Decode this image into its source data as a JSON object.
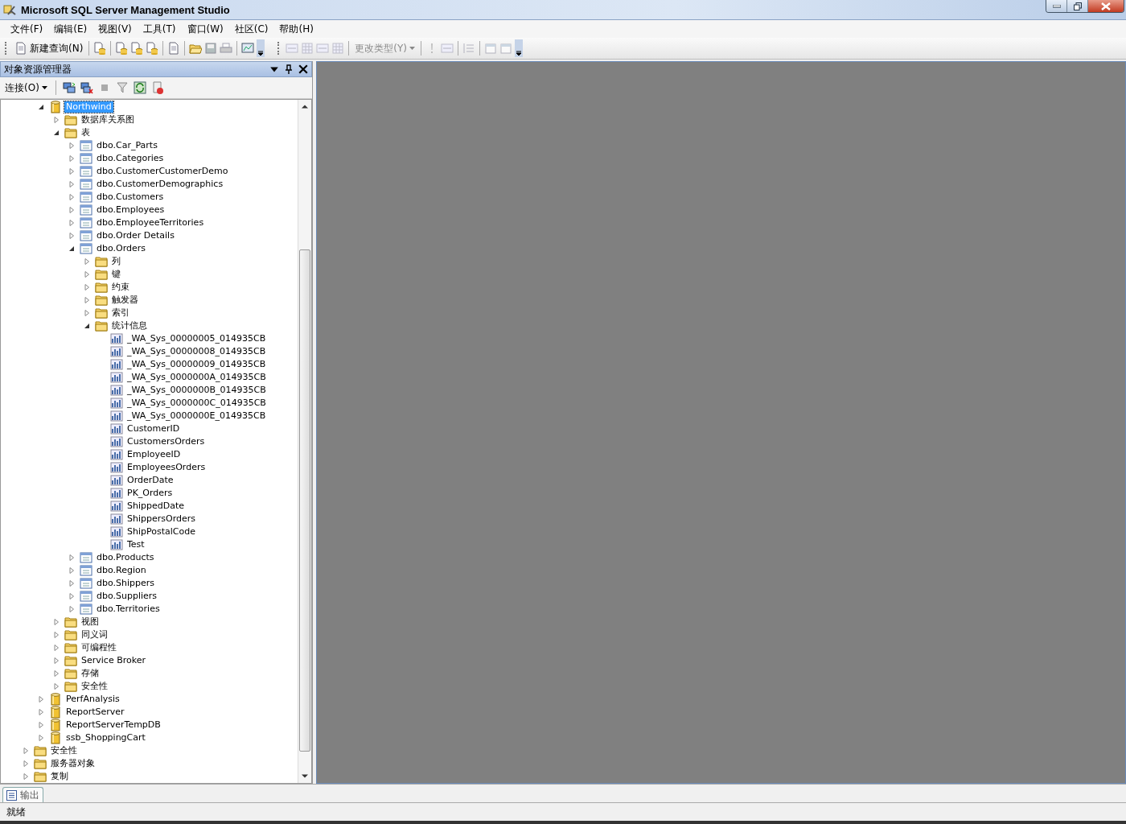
{
  "window": {
    "title": "Microsoft SQL Server Management Studio"
  },
  "menu": [
    "文件(F)",
    "编辑(E)",
    "视图(V)",
    "工具(T)",
    "窗口(W)",
    "社区(C)",
    "帮助(H)"
  ],
  "toolbar": {
    "new_query": {
      "label": "新建查询(N)",
      "disabled": false
    },
    "change_type": {
      "label": "更改类型(Y)",
      "disabled": true
    }
  },
  "object_explorer": {
    "title": "对象资源管理器",
    "connect": "连接(O)",
    "databases": [
      {
        "kind": "database",
        "label": "Northwind",
        "selected": true,
        "expanded": true,
        "children": [
          {
            "kind": "folder",
            "label": "数据库关系图",
            "expanded": false
          },
          {
            "kind": "folder",
            "label": "表",
            "expanded": true,
            "children": [
              {
                "kind": "table",
                "label": "dbo.Car_Parts",
                "expanded": false
              },
              {
                "kind": "table",
                "label": "dbo.Categories",
                "expanded": false
              },
              {
                "kind": "table",
                "label": "dbo.CustomerCustomerDemo",
                "expanded": false
              },
              {
                "kind": "table",
                "label": "dbo.CustomerDemographics",
                "expanded": false
              },
              {
                "kind": "table",
                "label": "dbo.Customers",
                "expanded": false
              },
              {
                "kind": "table",
                "label": "dbo.Employees",
                "expanded": false
              },
              {
                "kind": "table",
                "label": "dbo.EmployeeTerritories",
                "expanded": false
              },
              {
                "kind": "table",
                "label": "dbo.Order Details",
                "expanded": false
              },
              {
                "kind": "table",
                "label": "dbo.Orders",
                "expanded": true,
                "children": [
                  {
                    "kind": "folder",
                    "label": "列",
                    "expanded": false
                  },
                  {
                    "kind": "folder",
                    "label": "键",
                    "expanded": false
                  },
                  {
                    "kind": "folder",
                    "label": "约束",
                    "expanded": false
                  },
                  {
                    "kind": "folder",
                    "label": "触发器",
                    "expanded": false
                  },
                  {
                    "kind": "folder",
                    "label": "索引",
                    "expanded": false
                  },
                  {
                    "kind": "folder",
                    "label": "统计信息",
                    "expanded": true,
                    "children": [
                      {
                        "kind": "statistic",
                        "label": "_WA_Sys_00000005_014935CB"
                      },
                      {
                        "kind": "statistic",
                        "label": "_WA_Sys_00000008_014935CB"
                      },
                      {
                        "kind": "statistic",
                        "label": "_WA_Sys_00000009_014935CB"
                      },
                      {
                        "kind": "statistic",
                        "label": "_WA_Sys_0000000A_014935CB"
                      },
                      {
                        "kind": "statistic",
                        "label": "_WA_Sys_0000000B_014935CB"
                      },
                      {
                        "kind": "statistic",
                        "label": "_WA_Sys_0000000C_014935CB"
                      },
                      {
                        "kind": "statistic",
                        "label": "_WA_Sys_0000000E_014935CB"
                      },
                      {
                        "kind": "statistic",
                        "label": "CustomerID"
                      },
                      {
                        "kind": "statistic",
                        "label": "CustomersOrders"
                      },
                      {
                        "kind": "statistic",
                        "label": "EmployeeID"
                      },
                      {
                        "kind": "statistic",
                        "label": "EmployeesOrders"
                      },
                      {
                        "kind": "statistic",
                        "label": "OrderDate"
                      },
                      {
                        "kind": "statistic",
                        "label": "PK_Orders"
                      },
                      {
                        "kind": "statistic",
                        "label": "ShippedDate"
                      },
                      {
                        "kind": "statistic",
                        "label": "ShippersOrders"
                      },
                      {
                        "kind": "statistic",
                        "label": "ShipPostalCode"
                      },
                      {
                        "kind": "statistic",
                        "label": "Test"
                      }
                    ]
                  }
                ]
              },
              {
                "kind": "table",
                "label": "dbo.Products",
                "expanded": false
              },
              {
                "kind": "table",
                "label": "dbo.Region",
                "expanded": false
              },
              {
                "kind": "table",
                "label": "dbo.Shippers",
                "expanded": false
              },
              {
                "kind": "table",
                "label": "dbo.Suppliers",
                "expanded": false
              },
              {
                "kind": "table",
                "label": "dbo.Territories",
                "expanded": false
              }
            ]
          },
          {
            "kind": "folder",
            "label": "视图",
            "expanded": false
          },
          {
            "kind": "folder",
            "label": "同义词",
            "expanded": false
          },
          {
            "kind": "folder",
            "label": "可编程性",
            "expanded": false
          },
          {
            "kind": "folder",
            "label": "Service Broker",
            "expanded": false
          },
          {
            "kind": "folder",
            "label": "存储",
            "expanded": false
          },
          {
            "kind": "folder",
            "label": "安全性",
            "expanded": false
          }
        ]
      },
      {
        "kind": "database",
        "label": "PerfAnalysis",
        "selected": false,
        "expanded": false
      },
      {
        "kind": "database",
        "label": "ReportServer",
        "selected": false,
        "expanded": false
      },
      {
        "kind": "database",
        "label": "ReportServerTempDB",
        "selected": false,
        "expanded": false
      },
      {
        "kind": "database",
        "label": "ssb_ShoppingCart",
        "selected": false,
        "expanded": false
      }
    ],
    "server_folders": [
      {
        "kind": "folder",
        "label": "安全性",
        "expanded": false
      },
      {
        "kind": "folder",
        "label": "服务器对象",
        "expanded": false
      },
      {
        "kind": "folder",
        "label": "复制",
        "expanded": false
      }
    ]
  },
  "bottom_tabs": [
    {
      "label": "输出",
      "selected": true
    }
  ],
  "status_bar": "就绪"
}
